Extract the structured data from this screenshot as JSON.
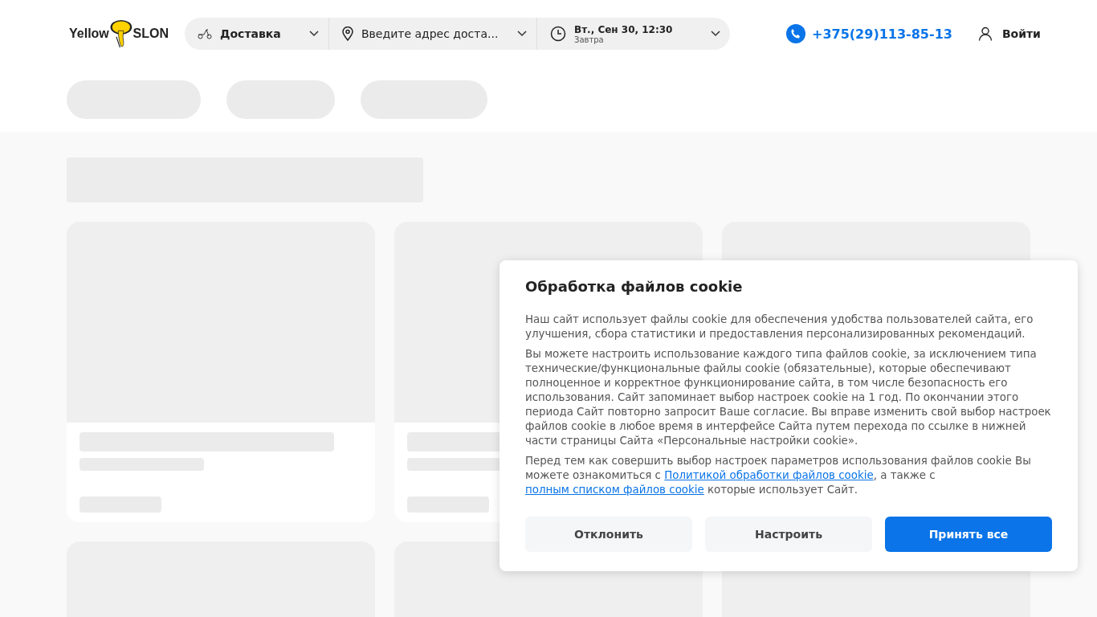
{
  "header": {
    "logo": {
      "left": "Yellow",
      "right": "SLON"
    },
    "delivery_mode": {
      "label": "Доставка"
    },
    "address": {
      "placeholder": "Введите адрес доста..."
    },
    "time": {
      "value": "Вт., Сен 30, 12:30",
      "note": "Завтра"
    },
    "phone": "+375(29)113-85-13",
    "login": "Войти"
  },
  "cookie_dialog": {
    "title": "Обработка файлов cookie",
    "paragraphs": [
      [
        {
          "kind": "text",
          "text": "Наш сайт использует файлы cookie для обеспечения удобства пользователей сайта, его улучшения, сбора статистики и предоставления персонализированных рекомендаций."
        }
      ],
      [
        {
          "kind": "text",
          "text": "Вы можете настроить использование каждого типа файлов cookie, за исключением типа технические/функциональные файлы cookie (обязательные), которые обеспечивают полноценное и корректное функционирование сайта, в том числе безопасность его использования. Сайт запоминает выбор настроек cookie на 1 год. По окончании этого периода Сайт повторно запросит Ваше согласие. Вы вправе изменить свой выбор настроек файлов cookie в любое время в интерфейсе Сайта путем перехода по ссылке в нижней части страницы Сайта «Персональные настройки cookie»."
        }
      ],
      [
        {
          "kind": "text",
          "text": "Перед тем как совершить выбор настроек параметров использования файлов cookie Вы можете ознакомиться с "
        },
        {
          "kind": "link",
          "text": "Политикой обработки файлов cookie"
        },
        {
          "kind": "text",
          "text": ", а также с "
        },
        {
          "kind": "link",
          "text": "полным списком файлов cookie"
        },
        {
          "kind": "text",
          "text": " которые использует Сайт."
        }
      ]
    ],
    "buttons": [
      {
        "label": "Отклонить",
        "kind": "secondary"
      },
      {
        "label": "Настроить",
        "kind": "secondary"
      },
      {
        "label": "Принять все",
        "kind": "primary"
      }
    ]
  }
}
